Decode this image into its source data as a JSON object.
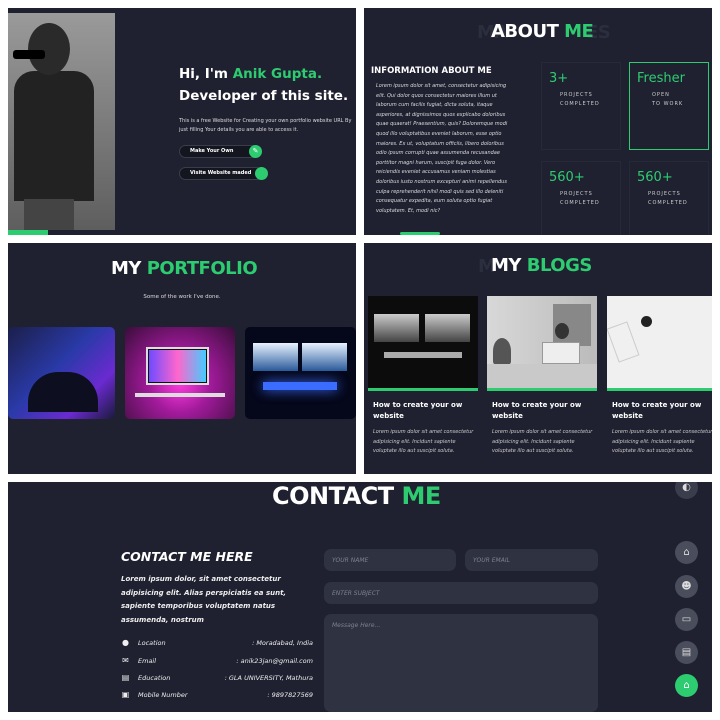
{
  "hero": {
    "greeting_prefix": "Hi, I'm ",
    "greeting_name": "Anik Gupta.",
    "role": "Developer of this site.",
    "description": "This is a free Website for Creating your own portfolio website URL By just filling Your details you are able to access it.",
    "make_own_label": "Make Your Own",
    "visit_label": "Visite Website maded",
    "make_own_icon": "edit-icon",
    "visit_icon": "dot-icon"
  },
  "about": {
    "title_word1": "ABOUT",
    "title_word2": "ME",
    "info_heading": "INFORMATION ABOUT ME",
    "info_text": "Lorem ipsum dolor sit amet, consectetur adipisicing elit. Qui dolor quos consectetur maiores illum ut laborum cum facilis fugiat, dicta soluta, itaque asperiores, at dignissimos quos explicabo doloribus quae quaerat! Praesentium, quis? Doloremque modi quod illo voluptatibus eveniet laborum, esse optio maiores. Ex ut, voluptatum officiis, libero doloribus odio ipsum corrupti quae assumenda recusandae porttitor magni harum, suscipit fuga dolor. Vero reiciendis eveniet accusamus veniam molestias doloribus iusto nostrum excepturi animi repellendus culpa reprehenderit nihil modi quis sed illo deleniti consequatur expedita, eum soluta optio fugiat voluptatem. Et, modi nic?",
    "stats": [
      {
        "num": "3+",
        "line1": "PROJECTS",
        "line2": "COMPLETED"
      },
      {
        "num": "Fresher",
        "line1": "OPEN",
        "line2": "TO WORK"
      },
      {
        "num": "560+",
        "line1": "PROJECTS",
        "line2": "COMPLETED"
      },
      {
        "num": "560+",
        "line1": "PROJECTS",
        "line2": "COMPLETED"
      }
    ]
  },
  "portfolio": {
    "title_word1": "MY",
    "title_word2": "PORTFOLIO",
    "subtitle": "Some of the work I've done."
  },
  "blogs": {
    "title_word1": "MY",
    "title_word2": "BLOGS",
    "items": [
      {
        "title": "How to create your ow website",
        "body": "Lorem ipsum dolor sit amet consectetur adipisicing elit. Incidunt sapiente voluptate illo aut suscipit soluta."
      },
      {
        "title": "How to create your ow website",
        "body": "Lorem ipsum dolor sit amet consectetur adipisicing elit. Incidunt sapiente voluptate illo aut suscipit soluta."
      },
      {
        "title": "How to create your ow website",
        "body": "Lorem ipsum dolor sit amet consectetur adipisicing elit. Incidunt sapiente voluptate illo aut suscipit soluta."
      }
    ]
  },
  "contact": {
    "title_word1": "CONTACT",
    "title_word2": "ME",
    "heading": "CONTACT ME HERE",
    "text": "Lorem ipsum dolor, sit amet consectetur adipisicing elit. Alias perspiciatis ea sunt, sapiente temporibus voluptatem natus assumenda, nostrum",
    "rows": [
      {
        "icon": "location-icon",
        "label": "Location",
        "value": ": Moradabad, India"
      },
      {
        "icon": "email-icon",
        "label": "Email",
        "value": ": anik23jan@gmail.com"
      },
      {
        "icon": "education-icon",
        "label": "Education",
        "value": ": GLA UNIVERSITY, Mathura"
      },
      {
        "icon": "phone-icon",
        "label": "Mobile Number",
        "value": ": 9897827569"
      }
    ],
    "name_placeholder": "YOUR NAME",
    "email_placeholder": "YOUR EMAIL",
    "subject_placeholder": "ENTER SUBJECT",
    "message_placeholder": "Message Here..."
  },
  "sidebar": {
    "icons": [
      "theme-toggle-icon",
      "home-icon",
      "user-icon",
      "briefcase-icon",
      "blog-icon",
      "contact-icon"
    ]
  },
  "colors": {
    "accent": "#2ecc71",
    "panel": "#1f2130"
  }
}
